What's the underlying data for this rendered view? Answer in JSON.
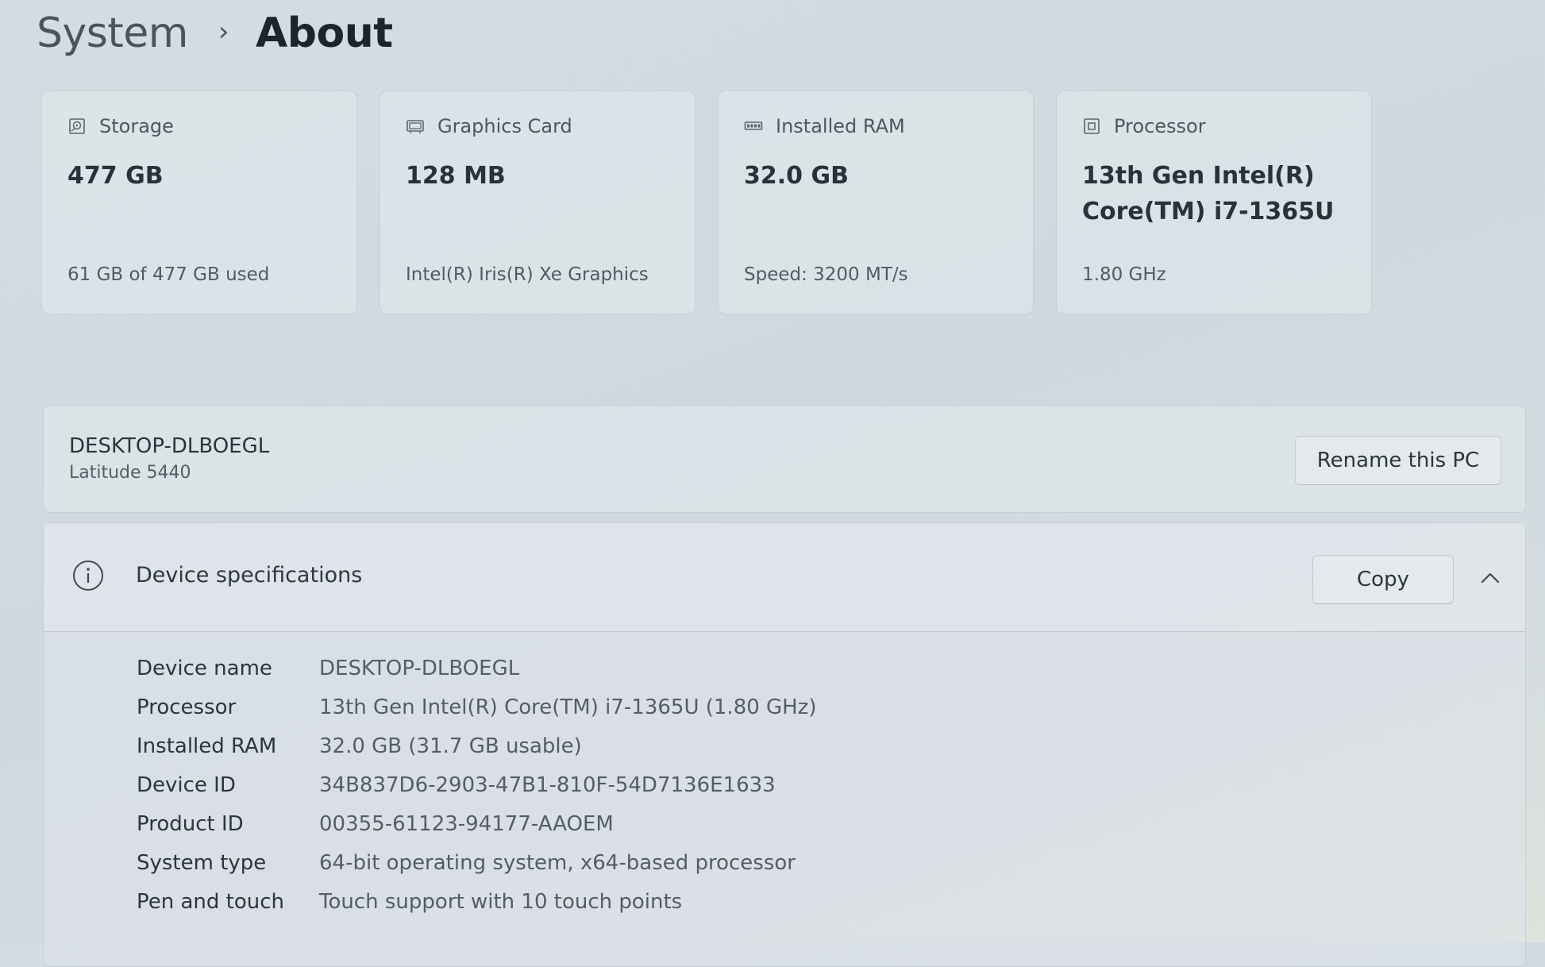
{
  "breadcrumb": {
    "parent": "System",
    "separator": "›",
    "current": "About"
  },
  "cards": [
    {
      "icon": "storage-icon",
      "label": "Storage",
      "value": "477 GB",
      "sub": "61 GB of 477 GB used"
    },
    {
      "icon": "graphics-card-icon",
      "label": "Graphics Card",
      "value": "128 MB",
      "sub": "Intel(R) Iris(R) Xe Graphics"
    },
    {
      "icon": "ram-icon",
      "label": "Installed RAM",
      "value": "32.0 GB",
      "sub": "Speed: 3200 MT/s"
    },
    {
      "icon": "processor-icon",
      "label": "Processor",
      "value": "13th Gen Intel(R) Core(TM) i7-1365U",
      "sub": "1.80 GHz"
    }
  ],
  "pc": {
    "name": "DESKTOP-DLBOEGL",
    "model": "Latitude 5440",
    "rename_label": "Rename this PC"
  },
  "specs": {
    "icon": "info-icon",
    "title": "Device specifications",
    "copy_label": "Copy",
    "rows": [
      {
        "label": "Device name",
        "value": "DESKTOP-DLBOEGL"
      },
      {
        "label": "Processor",
        "value": "13th Gen Intel(R) Core(TM) i7-1365U (1.80 GHz)"
      },
      {
        "label": "Installed RAM",
        "value": "32.0 GB (31.7 GB usable)"
      },
      {
        "label": "Device ID",
        "value": "34B837D6-2903-47B1-810F-54D7136E1633"
      },
      {
        "label": "Product ID",
        "value": "00355-61123-94177-AAOEM"
      },
      {
        "label": "System type",
        "value": "64-bit operating system, x64-based processor"
      },
      {
        "label": "Pen and touch",
        "value": "Touch support with 10 touch points"
      }
    ]
  }
}
